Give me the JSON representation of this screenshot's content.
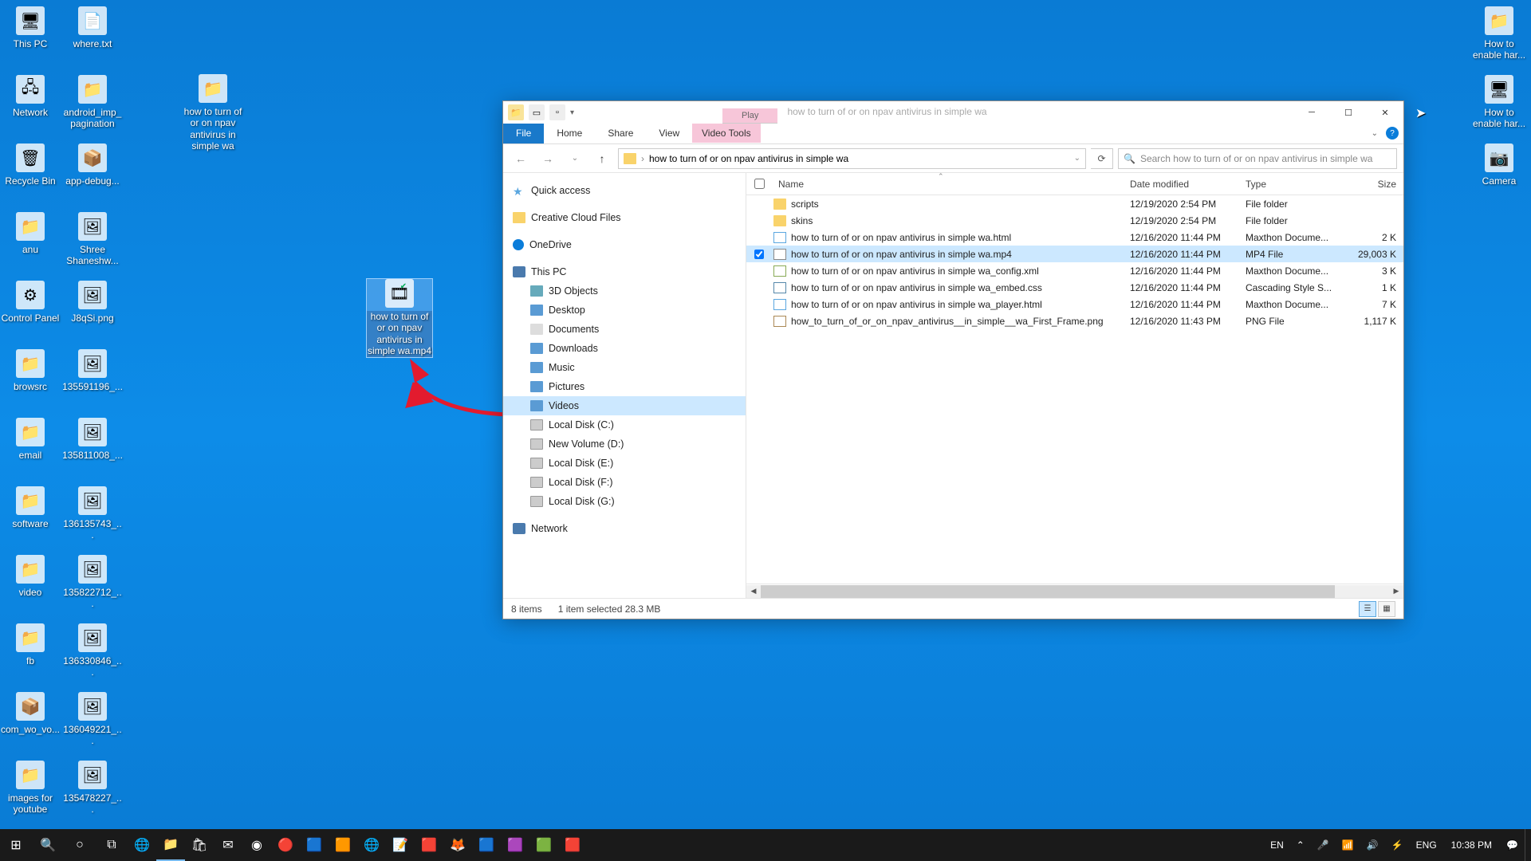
{
  "desktop": {
    "icons_left": [
      {
        "label": "This PC",
        "glyph": "🖥"
      },
      {
        "label": "Network",
        "glyph": "🖧"
      },
      {
        "label": "Recycle Bin",
        "glyph": "🗑"
      },
      {
        "label": "anu",
        "glyph": "📁"
      },
      {
        "label": "Control Panel",
        "glyph": "⚙"
      },
      {
        "label": "browsrc",
        "glyph": "📁"
      },
      {
        "label": "email",
        "glyph": "📁"
      },
      {
        "label": "software",
        "glyph": "📁"
      },
      {
        "label": "video",
        "glyph": "📁"
      },
      {
        "label": "fb",
        "glyph": "📁"
      },
      {
        "label": "com_wo_vo...",
        "glyph": "📦"
      },
      {
        "label": "images for youtube",
        "glyph": "📁"
      }
    ],
    "icons_col2": [
      {
        "label": "where.txt",
        "glyph": "📄"
      },
      {
        "label": "android_imp_pagination",
        "glyph": "📁"
      },
      {
        "label": "app-debug...",
        "glyph": "📦"
      },
      {
        "label": "Shree Shaneshw...",
        "glyph": "🖼"
      },
      {
        "label": "J8qSi.png",
        "glyph": "🖼"
      },
      {
        "label": "135591196_...",
        "glyph": "🖼"
      },
      {
        "label": "135811008_...",
        "glyph": "🖼"
      },
      {
        "label": "136135743_...",
        "glyph": "🖼"
      },
      {
        "label": "135822712_...",
        "glyph": "🖼"
      },
      {
        "label": "136330846_...",
        "glyph": "🖼"
      },
      {
        "label": "136049221_...",
        "glyph": "🖼"
      },
      {
        "label": "135478227_...",
        "glyph": "🖼"
      }
    ],
    "icon_center": {
      "label": "how to turn of or on npav antivirus  in simple  wa",
      "glyph": "📁"
    },
    "icon_selected": {
      "label": "how to turn of or on npav antivirus  in simple  wa.mp4",
      "glyph": "🎞"
    },
    "icons_right": [
      {
        "label": "How to enable har...",
        "glyph": "📁"
      },
      {
        "label": "How to enable har...",
        "glyph": "🖥"
      },
      {
        "label": "Camera",
        "glyph": "📷"
      }
    ]
  },
  "explorer": {
    "title": "how to turn of or on npav antivirus  in simple  wa",
    "contextual_tab_group": "Play",
    "ribbon": {
      "file": "File",
      "home": "Home",
      "share": "Share",
      "view": "View",
      "video_tools": "Video Tools"
    },
    "address": "how to turn of or on npav antivirus  in simple  wa",
    "search_placeholder": "Search how to turn of or on npav antivirus  in simple  wa",
    "nav": {
      "quick_access": "Quick access",
      "creative_cloud": "Creative Cloud Files",
      "onedrive": "OneDrive",
      "this_pc": "This PC",
      "objects3d": "3D Objects",
      "desktop": "Desktop",
      "documents": "Documents",
      "downloads": "Downloads",
      "music": "Music",
      "pictures": "Pictures",
      "videos": "Videos",
      "disk_c": "Local Disk (C:)",
      "disk_d": "New Volume (D:)",
      "disk_e": "Local Disk (E:)",
      "disk_f": "Local Disk (F:)",
      "disk_g": "Local Disk (G:)",
      "network": "Network"
    },
    "columns": {
      "name": "Name",
      "date": "Date modified",
      "type": "Type",
      "size": "Size"
    },
    "files": [
      {
        "name": "scripts",
        "date": "12/19/2020 2:54 PM",
        "type": "File folder",
        "size": "",
        "ico": "folder"
      },
      {
        "name": "skins",
        "date": "12/19/2020 2:54 PM",
        "type": "File folder",
        "size": "",
        "ico": "folder"
      },
      {
        "name": "how to turn of or on npav antivirus  in simple  wa.html",
        "date": "12/16/2020 11:44 PM",
        "type": "Maxthon Docume...",
        "size": "2 K",
        "ico": "html"
      },
      {
        "name": "how to turn of or on npav antivirus  in simple  wa.mp4",
        "date": "12/16/2020 11:44 PM",
        "type": "MP4 File",
        "size": "29,003 K",
        "ico": "mp4",
        "selected": true,
        "checked": true
      },
      {
        "name": "how to turn of or on npav antivirus  in simple  wa_config.xml",
        "date": "12/16/2020 11:44 PM",
        "type": "Maxthon Docume...",
        "size": "3 K",
        "ico": "xml"
      },
      {
        "name": "how to turn of or on npav antivirus  in simple  wa_embed.css",
        "date": "12/16/2020 11:44 PM",
        "type": "Cascading Style S...",
        "size": "1 K",
        "ico": "css"
      },
      {
        "name": "how to turn of or on npav antivirus  in simple  wa_player.html",
        "date": "12/16/2020 11:44 PM",
        "type": "Maxthon Docume...",
        "size": "7 K",
        "ico": "html"
      },
      {
        "name": "how_to_turn_of_or_on_npav_antivirus__in_simple__wa_First_Frame.png",
        "date": "12/16/2020 11:43 PM",
        "type": "PNG File",
        "size": "1,117 K",
        "ico": "png"
      }
    ],
    "status": {
      "items": "8 items",
      "selection": "1 item selected  28.3 MB"
    }
  },
  "taskbar": {
    "lang1": "EN",
    "lang2": "ENG",
    "time": "10:38 PM"
  }
}
